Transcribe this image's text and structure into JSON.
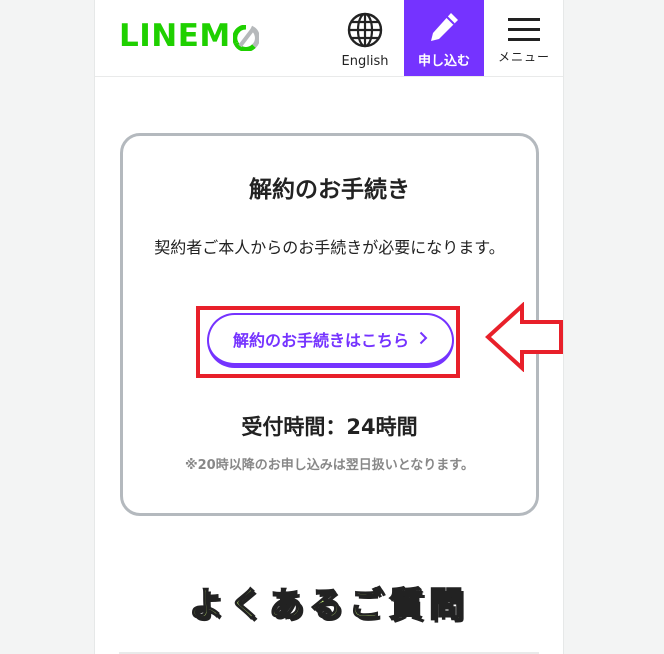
{
  "header": {
    "logo_text": "LINEMO",
    "logo_color": "#1fd000",
    "nav": {
      "english": {
        "label": "English",
        "icon": "globe-icon"
      },
      "apply": {
        "label": "申し込む",
        "icon": "pencil-icon",
        "bg_color": "#7533ff"
      },
      "menu": {
        "label": "メニュー",
        "icon": "hamburger-icon"
      }
    }
  },
  "card": {
    "title": "解約のお手続き",
    "description": "契約者ご本人からのお手続きが必要になります。",
    "cta_label": "解約のお手続きはこちら",
    "cta_icon": "chevron-right-icon",
    "hours": "受付時間：24時間",
    "note": "※20時以降のお申し込みは翌日扱いとなります。"
  },
  "faq": {
    "title": "よくあるご質問"
  },
  "annotations": {
    "highlight_color": "#e8202a",
    "arrow_icon": "left-arrow-icon"
  }
}
